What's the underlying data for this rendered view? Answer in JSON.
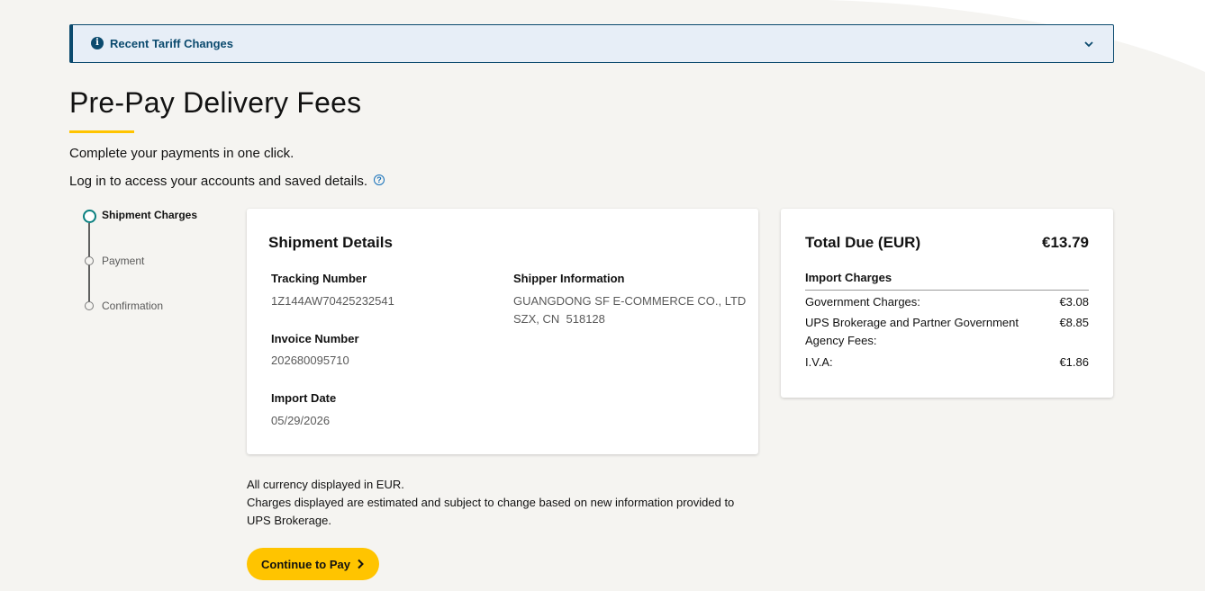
{
  "alert": {
    "title": "Recent Tariff Changes",
    "icon": "info-icon",
    "toggle_icon": "chevron-down-icon"
  },
  "header": {
    "title": "Pre-Pay Delivery Fees",
    "subtitle": "Complete your payments in one click.",
    "login_text": "Log in to access your accounts and saved details.",
    "help_icon": "help-icon"
  },
  "stepper": {
    "steps": [
      {
        "label": "Shipment Charges",
        "active": true
      },
      {
        "label": "Payment",
        "active": false
      },
      {
        "label": "Confirmation",
        "active": false
      }
    ]
  },
  "shipment": {
    "title": "Shipment Details",
    "tracking_label": "Tracking Number",
    "tracking_value": "1Z144AW70425232541",
    "invoice_label": "Invoice Number",
    "invoice_value": "202680095710",
    "import_date_label": "Import Date",
    "import_date_value": "05/29/2026",
    "shipper_label": "Shipper Information",
    "shipper_line1": "GUANGDONG SF E-COMMERCE CO., LTD",
    "shipper_line2": "SZX, CN  518128"
  },
  "totals": {
    "label": "Total Due (EUR)",
    "amount": "€13.79",
    "section_title": "Import Charges",
    "charges": [
      {
        "label": "Government Charges:",
        "amount": "€3.08"
      },
      {
        "label": "UPS Brokerage and Partner Government Agency Fees:",
        "amount": "€8.85"
      },
      {
        "label": "I.V.A:",
        "amount": "€1.86"
      }
    ]
  },
  "notes": {
    "line1": "All currency displayed in EUR.",
    "line2": "Charges displayed are estimated and subject to change based on new information provided to UPS Brokerage."
  },
  "actions": {
    "continue_label": "Continue to Pay"
  },
  "colors": {
    "accent": "#ffc400",
    "alert_border": "#0b4a6e",
    "alert_bg": "#e7eef7",
    "active_step": "#0a8080"
  }
}
